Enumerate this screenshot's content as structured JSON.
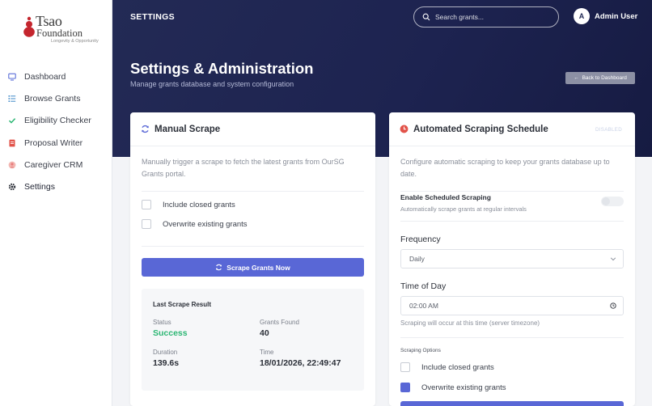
{
  "brand": {
    "name": "Tsao",
    "name_line2": "Foundation",
    "tagline": "Longevity & Opportunity",
    "color": "#c4262e"
  },
  "sidebar": {
    "items": [
      {
        "label": "Dashboard",
        "icon": "monitor-icon",
        "color": "#5b6fd8"
      },
      {
        "label": "Browse Grants",
        "icon": "list-icon",
        "color": "#3f88c8"
      },
      {
        "label": "Eligibility Checker",
        "icon": "check-icon",
        "color": "#2bb673"
      },
      {
        "label": "Proposal Writer",
        "icon": "document-icon",
        "color": "#e2534a"
      },
      {
        "label": "Caregiver CRM",
        "icon": "person-icon",
        "color": "#e77c7c"
      },
      {
        "label": "Settings",
        "icon": "gear-icon",
        "color": "#2b2f38",
        "active": true
      }
    ]
  },
  "header": {
    "section": "SETTINGS",
    "search_placeholder": "Search grants...",
    "user_initial": "A",
    "user_name": "Admin User",
    "page_title": "Settings & Administration",
    "page_subtitle": "Manage grants database and system configuration",
    "back_button": "Back to Dashboard"
  },
  "manual": {
    "title": "Manual Scrape",
    "description": "Manually trigger a scrape to fetch the latest grants from OurSG Grants portal.",
    "options": [
      {
        "label": "Include closed grants",
        "checked": false
      },
      {
        "label": "Overwrite existing grants",
        "checked": false
      }
    ],
    "button": "Scrape Grants Now",
    "result": {
      "title": "Last Scrape Result",
      "status_label": "Status",
      "status_value": "Success",
      "found_label": "Grants Found",
      "found_value": "40",
      "duration_label": "Duration",
      "duration_value": "139.6s",
      "time_label": "Time",
      "time_value": "18/01/2026, 22:49:47"
    }
  },
  "auto": {
    "title": "Automated Scraping Schedule",
    "status_tag": "DISABLED",
    "description": "Configure automatic scraping to keep your grants database up to date.",
    "enable_label": "Enable Scheduled Scraping",
    "enable_hint": "Automatically scrape grants at regular intervals",
    "enabled": false,
    "frequency_label": "Frequency",
    "frequency_value": "Daily",
    "time_label": "Time of Day",
    "time_value": "02:00 AM",
    "time_hint": "Scraping will occur at this time (server timezone)",
    "options_label": "Scraping Options",
    "options": [
      {
        "label": "Include closed grants",
        "checked": false
      },
      {
        "label": "Overwrite existing grants",
        "checked": true
      }
    ]
  },
  "colors": {
    "accent": "#5967d6",
    "success": "#2bb673",
    "header_bg": "#1d2350",
    "schedule_icon": "#e2534a"
  }
}
